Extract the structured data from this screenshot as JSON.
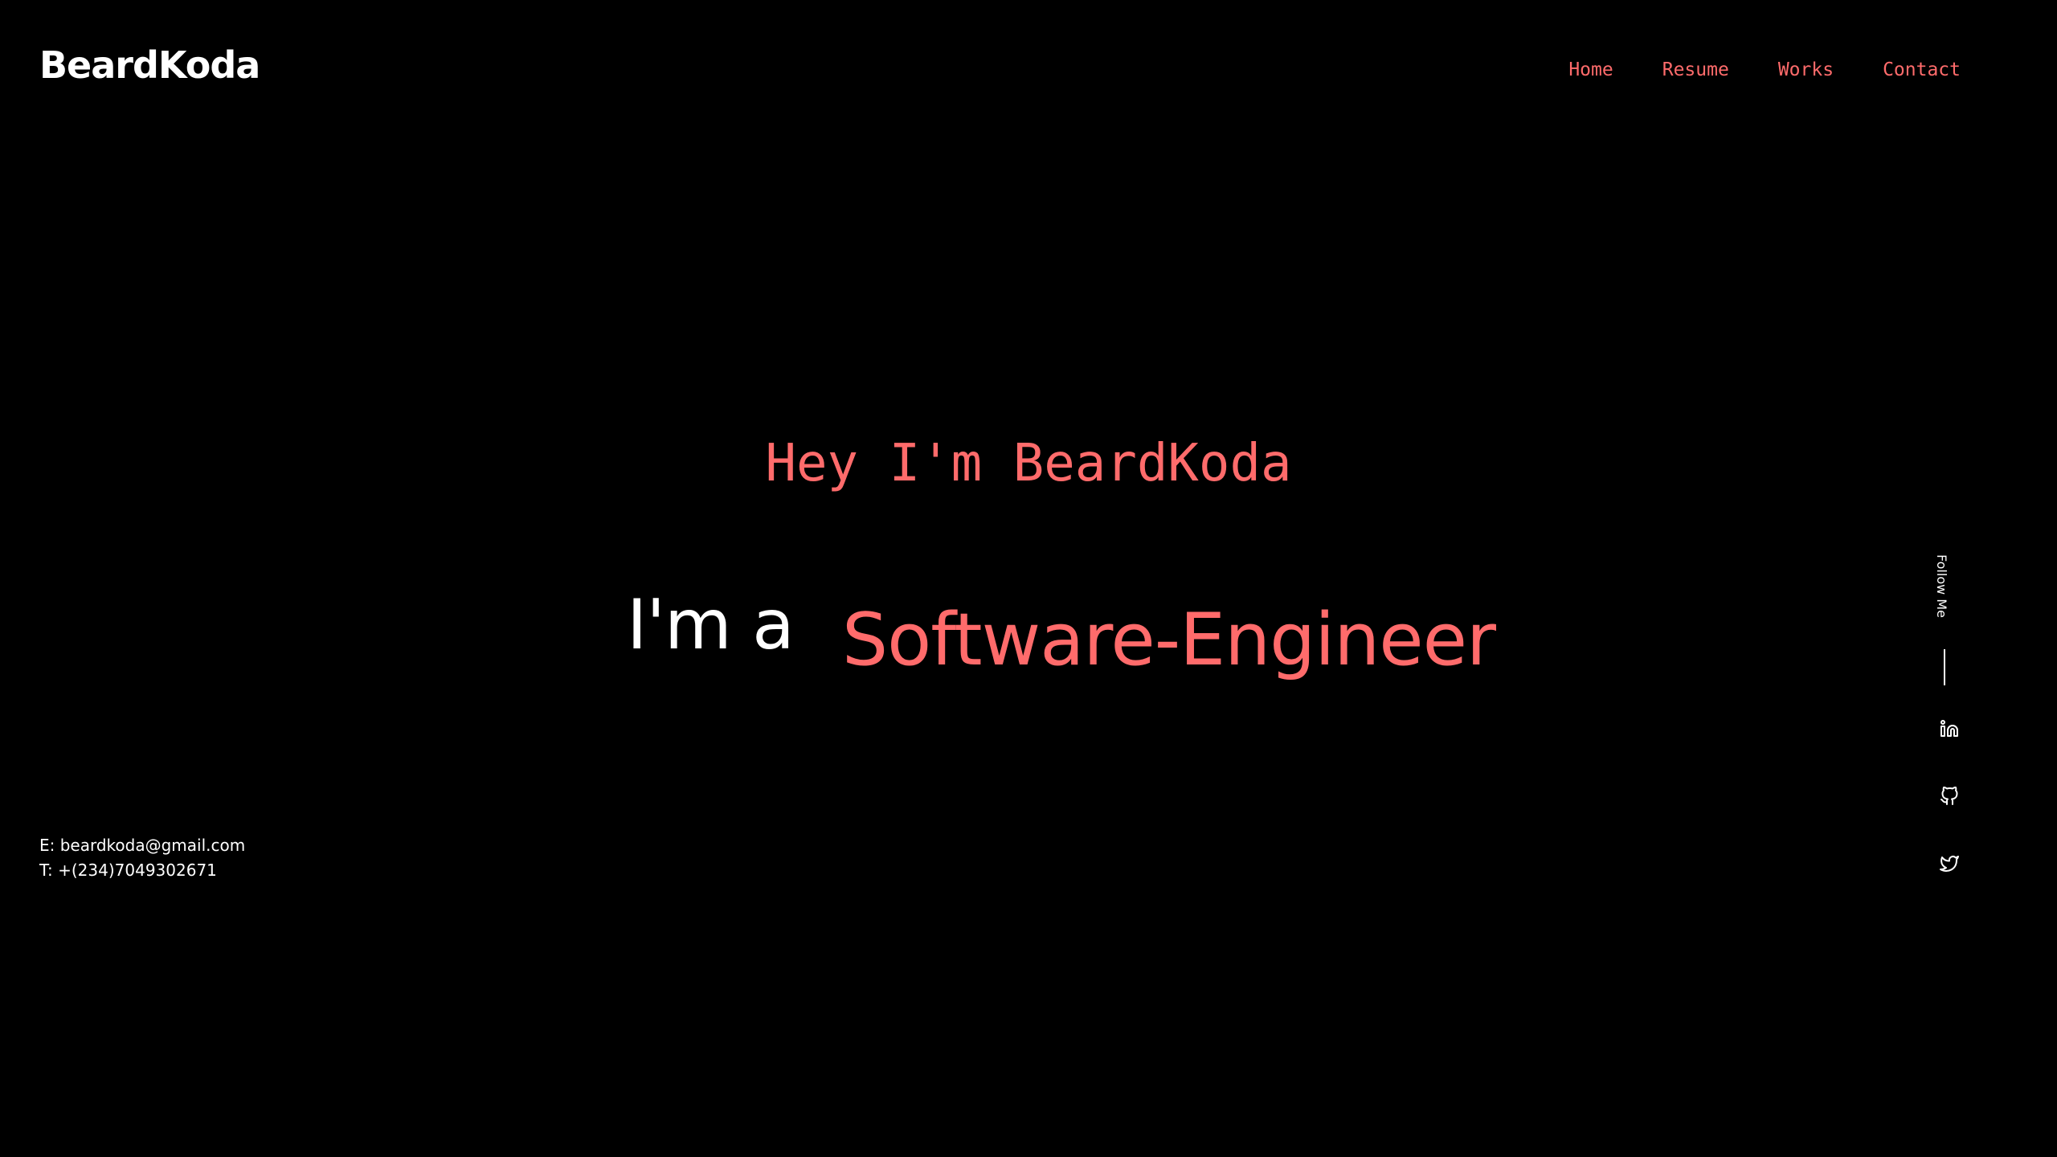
{
  "header": {
    "brand": "BeardKoda",
    "nav": [
      {
        "label": "Home"
      },
      {
        "label": "Resume"
      },
      {
        "label": "Works"
      },
      {
        "label": "Contact"
      }
    ]
  },
  "hero": {
    "greeting": "Hey I'm BeardKoda",
    "intro": "I'm a",
    "role": "Software-Engineer"
  },
  "contact": {
    "email": "E: beardkoda@gmail.com",
    "phone": "T: +(234)7049302671"
  },
  "social": {
    "follow_label": "Follow Me",
    "icons": [
      "linkedin-icon",
      "github-icon",
      "twitter-icon"
    ]
  },
  "colors": {
    "background": "#000000",
    "accent": "#ff6b6b",
    "text": "#ffffff"
  }
}
